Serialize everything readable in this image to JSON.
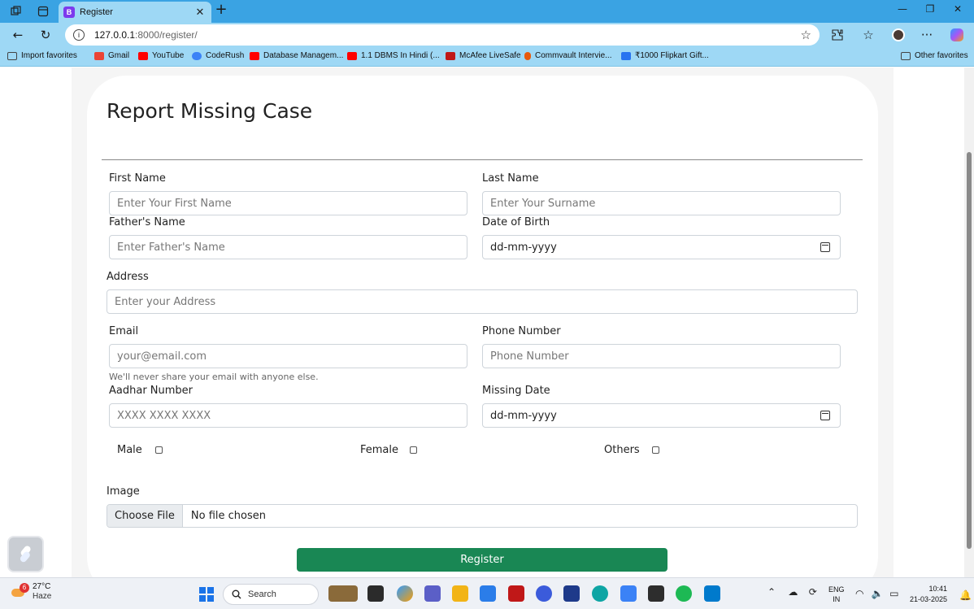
{
  "browser": {
    "tab_title": "Register",
    "tab_favicon_letter": "B",
    "url_host": "127.0.0.1",
    "url_rest": ":8000/register/",
    "favorites": [
      {
        "label": "Import favorites",
        "icon": "import-icon",
        "color": "#444444"
      },
      {
        "label": "Gmail",
        "icon": "gmail-icon",
        "color": "#ea4335"
      },
      {
        "label": "YouTube",
        "icon": "youtube-icon",
        "color": "#ff0000"
      },
      {
        "label": "CodeRush",
        "icon": "coderush-icon",
        "color": "#3b82f6"
      },
      {
        "label": "Database Managem...",
        "icon": "youtube-icon",
        "color": "#ff0000"
      },
      {
        "label": "1.1 DBMS In Hindi (...",
        "icon": "youtube-icon",
        "color": "#ff0000"
      },
      {
        "label": "McAfee LiveSafe",
        "icon": "mcafee-icon",
        "color": "#c01818"
      },
      {
        "label": "Commvault Intervie...",
        "icon": "pin-icon",
        "color": "#e8590c"
      },
      {
        "label": "₹1000 Flipkart Gift...",
        "icon": "flipkart-icon",
        "color": "#2874f0"
      }
    ],
    "other_favorites": "Other favorites"
  },
  "form": {
    "title": "Report Missing Case",
    "first_name_label": "First Name",
    "first_name_placeholder": "Enter Your First Name",
    "last_name_label": "Last Name",
    "last_name_placeholder": "Enter Your Surname",
    "father_name_label": "Father's Name",
    "father_name_placeholder": "Enter Father's Name",
    "dob_label": "Date of Birth",
    "dob_value": "dd-mm-yyyy",
    "address_label": "Address",
    "address_placeholder": "Enter your Address",
    "email_label": "Email",
    "email_placeholder": "your@email.com",
    "email_help": "We'll never share your email with anyone else.",
    "phone_label": "Phone Number",
    "phone_placeholder": "Phone Number",
    "aadhar_label": "Aadhar Number",
    "aadhar_placeholder": "XXXX XXXX XXXX",
    "missing_date_label": "Missing Date",
    "missing_date_value": "dd-mm-yyyy",
    "gender_options": [
      "Male",
      "Female",
      "Others"
    ],
    "image_label": "Image",
    "choose_file": "Choose File",
    "no_file": "No file chosen",
    "register_button": "Register",
    "accent_color": "#198754"
  },
  "taskbar": {
    "weather_badge": "6",
    "weather_temp": "27°C",
    "weather_condition": "Haze",
    "search_label": "Search",
    "lang_line1": "ENG",
    "lang_line2": "IN",
    "time": "10:41",
    "date": "21-03-2025"
  }
}
